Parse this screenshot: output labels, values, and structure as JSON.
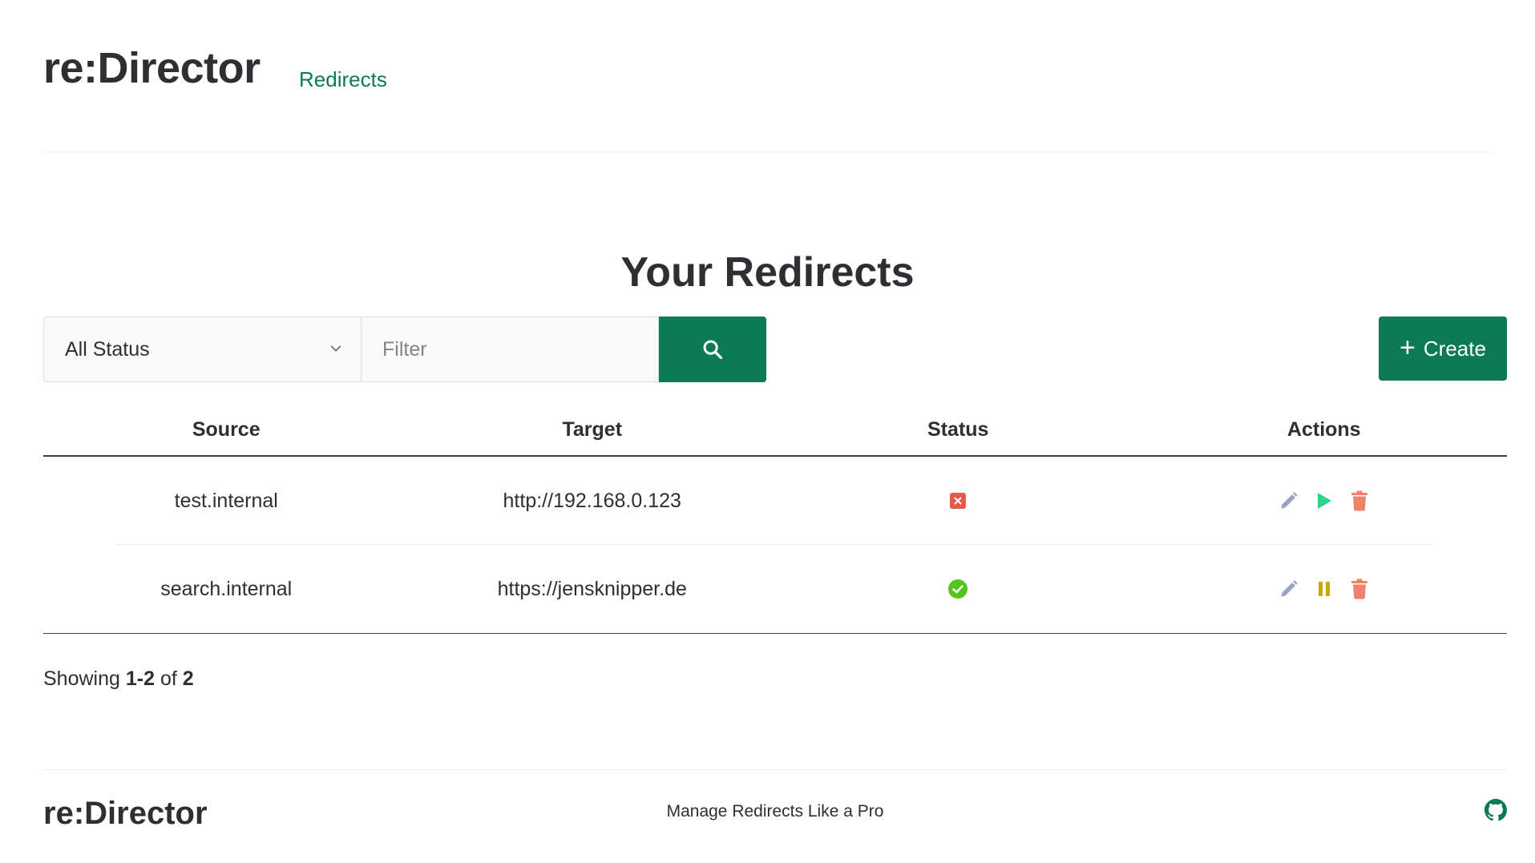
{
  "header": {
    "brand": "re:Director",
    "nav_link": "Redirects"
  },
  "main": {
    "title": "Your Redirects",
    "status_select_value": "All Status",
    "filter_placeholder": "Filter",
    "create_label": "Create"
  },
  "table": {
    "columns": [
      "Source",
      "Target",
      "Status",
      "Actions"
    ],
    "rows": [
      {
        "source": "test.internal",
        "target": "http://192.168.0.123",
        "status": "inactive",
        "status_icon": "error-icon",
        "toggle_icon": "play-icon"
      },
      {
        "source": "search.internal",
        "target": "https://jensknipper.de",
        "status": "active",
        "status_icon": "check-circle-icon",
        "toggle_icon": "pause-icon"
      }
    ]
  },
  "pagination": {
    "prefix": "Showing",
    "range": "1-2",
    "of": "of",
    "total": "2"
  },
  "footer": {
    "brand": "re:Director",
    "tagline": "Manage Redirects Like a Pro",
    "github_icon": "github-icon"
  },
  "colors": {
    "accent": "#0b7a55",
    "error": "#e25b4a",
    "success": "#52c41a",
    "play": "#2fd28a",
    "pause": "#c9a800",
    "delete": "#f0826c",
    "edit": "#9aa4c2"
  }
}
